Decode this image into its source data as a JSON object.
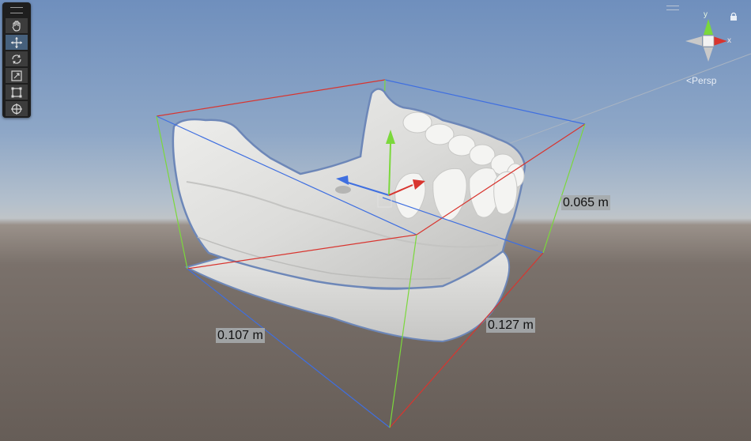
{
  "scene": {
    "view_mode_label": "Persp",
    "axis_x_label": "x",
    "axis_y_label": "y",
    "dimensions": {
      "height": "0.065 m",
      "width": "0.107 m",
      "depth": "0.127 m"
    }
  },
  "tools": [
    {
      "name": "hand-tool",
      "icon": "hand-icon",
      "active": false
    },
    {
      "name": "move-tool",
      "icon": "move-icon",
      "active": true
    },
    {
      "name": "rotate-tool",
      "icon": "rotate-icon",
      "active": false
    },
    {
      "name": "scale-tool",
      "icon": "scale-icon",
      "active": false
    },
    {
      "name": "rect-tool",
      "icon": "rect-icon",
      "active": false
    },
    {
      "name": "transform-tool",
      "icon": "transform-icon",
      "active": false
    }
  ],
  "colors": {
    "axis_x": "#d8352f",
    "axis_y": "#7bd83c",
    "axis_z": "#3f6fe0"
  }
}
